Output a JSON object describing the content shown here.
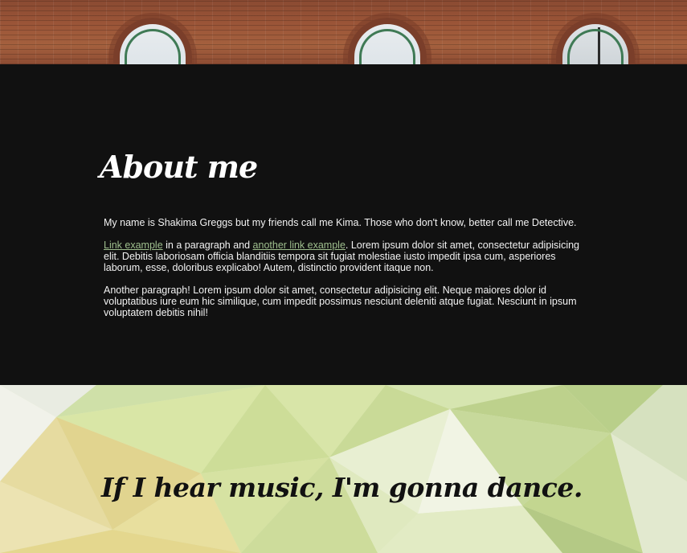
{
  "about": {
    "heading": "About me",
    "intro": "My name is Shakima Greggs but my friends call me Kima. Those who don't know, better call me Detective.",
    "para2": {
      "link1": "Link example",
      "text1": " in a paragraph and ",
      "link2": "another link example",
      "text2": ". Lorem ipsum dolor sit amet, consectetur adipisicing elit. Debitis laboriosam officia blanditiis tempora sit fugiat molestiae iusto impedit ipsa cum, asperiores laborum, esse, doloribus explicabo! Autem, distinctio provident itaque non."
    },
    "para3": "Another paragraph! Lorem ipsum dolor sit amet, consectetur adipisicing elit. Neque maiores dolor id voluptatibus iure eum hic similique, cum impedit possimus nesciunt deleniti atque fugiat. Nesciunt in ipsum voluptatem debitis nihil!"
  },
  "quote": {
    "text": "If I hear music, I'm gonna dance."
  },
  "colors": {
    "dark_bg": "#111111",
    "link": "#9fbf8e",
    "text": "#f2f2f2"
  }
}
